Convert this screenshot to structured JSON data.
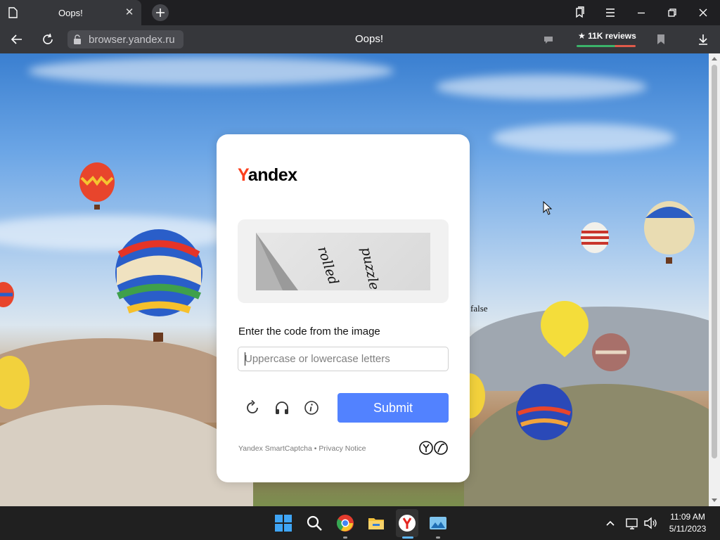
{
  "browser": {
    "tab": {
      "title": "Oops!",
      "close_icon": "close-icon"
    },
    "new_tab_icon": "plus-icon",
    "window_controls": [
      "collections-icon",
      "menu-icon",
      "minimize-icon",
      "restore-icon",
      "close-icon"
    ],
    "address_bar": {
      "url": "browser.yandex.ru",
      "page_title": "Oops!",
      "reviews": "★ 11K reviews"
    }
  },
  "page": {
    "stray_text": "false",
    "captcha": {
      "logo_first": "Y",
      "logo_rest": "andex",
      "prompt": "Enter the code from the image",
      "input_value": "",
      "input_placeholder": "Uppercase or lowercase letters",
      "submit_label": "Submit",
      "footer_product": "Yandex SmartCaptcha",
      "footer_separator": " • ",
      "footer_privacy": "Privacy Notice",
      "captcha_words": [
        "rolled",
        "puzzle"
      ]
    }
  },
  "taskbar": {
    "apps": [
      "windows-start-icon",
      "search-icon",
      "chrome-icon",
      "file-explorer-icon",
      "yandex-browser-icon",
      "photo-app-icon"
    ],
    "time": "11:09 AM",
    "date": "5/11/2023"
  },
  "colors": {
    "accent": "#5282ff",
    "yandex_red": "#fc3f1d",
    "reviews_good": "#3bb36a",
    "reviews_bad": "#e05a4a"
  }
}
